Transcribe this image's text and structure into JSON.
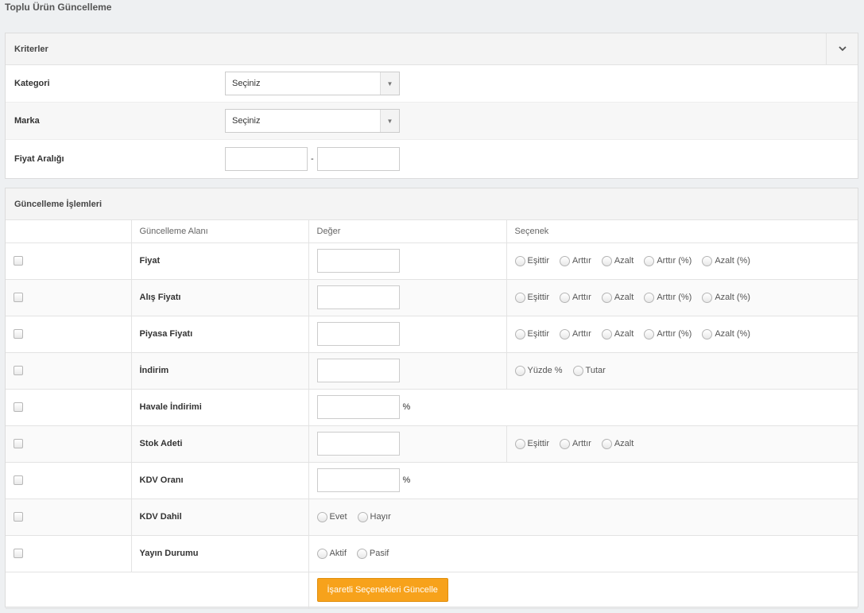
{
  "page": {
    "title": "Toplu Ürün Güncelleme"
  },
  "criteria": {
    "title": "Kriterler",
    "collapse_icon": "chevron-down-icon",
    "category": {
      "label": "Kategori",
      "selected": "Seçiniz"
    },
    "brand": {
      "label": "Marka",
      "selected": "Seçiniz"
    },
    "price_range": {
      "label": "Fiyat Aralığı",
      "min": "",
      "max": "",
      "separator": "-"
    }
  },
  "updates": {
    "title": "Güncelleme İşlemleri",
    "columns": [
      "Güncelleme Alanı",
      "Değer",
      "Seçenek"
    ],
    "rows": [
      {
        "field": "Fiyat",
        "value": "",
        "options": [
          "Eşittir",
          "Arttır",
          "Azalt",
          "Arttır (%)",
          "Azalt (%)"
        ]
      },
      {
        "field": "Alış Fiyatı",
        "value": "",
        "options": [
          "Eşittir",
          "Arttır",
          "Azalt",
          "Arttır (%)",
          "Azalt (%)"
        ]
      },
      {
        "field": "Piyasa Fiyatı",
        "value": "",
        "options": [
          "Eşittir",
          "Arttır",
          "Azalt",
          "Arttır (%)",
          "Azalt (%)"
        ]
      },
      {
        "field": "İndirim",
        "value": "",
        "options": [
          "Yüzde %",
          "Tutar"
        ]
      },
      {
        "field": "Havale İndirimi",
        "value": "",
        "suffix": "%"
      },
      {
        "field": "Stok Adeti",
        "value": "",
        "options": [
          "Eşittir",
          "Arttır",
          "Azalt"
        ]
      },
      {
        "field": "KDV Oranı",
        "value": "",
        "suffix": "%"
      },
      {
        "field": "KDV Dahil",
        "inline_options": [
          "Evet",
          "Hayır"
        ]
      },
      {
        "field": "Yayın Durumu",
        "inline_options": [
          "Aktif",
          "Pasif"
        ]
      }
    ],
    "submit_label": "İşaretli Seçenekleri Güncelle",
    "button_color": "#f7a21b"
  }
}
